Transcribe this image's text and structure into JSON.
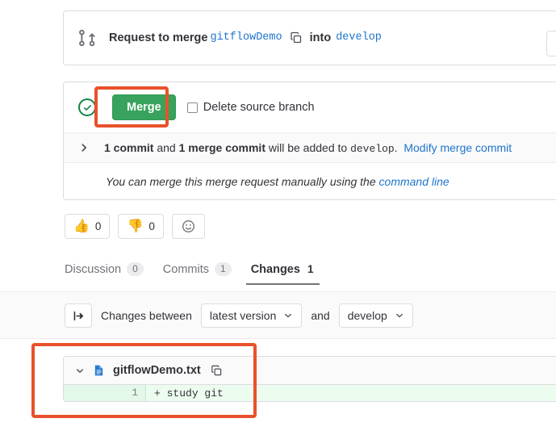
{
  "merge_request": {
    "icon": "merge-request-icon",
    "title_prefix": "Request to merge",
    "source_branch": "gitflowDemo",
    "copy_icon": "copy-icon",
    "into_word": "into",
    "target_branch": "develop"
  },
  "merge_widget": {
    "status_icon": "check-circle-icon",
    "merge_button": "Merge",
    "delete_source_branch_label": "Delete source branch",
    "delete_source_branch_checked": false,
    "expand_icon": "chevron-right-icon",
    "commit_count_text": "1 commit",
    "and_word": "and",
    "merge_commit_text": "1 merge commit",
    "commit_suffix": "will be added to",
    "commit_target": "develop",
    "commit_period": ".",
    "modify_link": "Modify merge commit",
    "manual_text_prefix": "You can merge this merge request manually using the",
    "manual_link": "command line"
  },
  "awards": [
    {
      "name": "thumbsup",
      "emoji": "👍",
      "count": "0"
    },
    {
      "name": "thumbsdown",
      "emoji": "👎",
      "count": "0"
    }
  ],
  "award_add_icon": "smiley-add-reaction-icon",
  "tabs": [
    {
      "label": "Discussion",
      "count": "0",
      "active": false
    },
    {
      "label": "Commits",
      "count": "1",
      "active": false
    },
    {
      "label": "Changes",
      "count": "1",
      "active": true
    }
  ],
  "compare_bar": {
    "toggle_icon": "sidebar-toggle-icon",
    "label": "Changes between",
    "version_dropdown": "latest version",
    "and_word": "and",
    "target_dropdown": "develop",
    "chevron_icon": "chevron-down-icon"
  },
  "file_diff": {
    "collapse_icon": "chevron-down-icon",
    "file_icon": "document-icon",
    "file_name": "gitflowDemo.txt",
    "copy_icon": "copy-icon",
    "lines": [
      {
        "number": "1",
        "marker": "+",
        "content": "study git",
        "type": "added"
      }
    ]
  },
  "colors": {
    "merge_green": "#37a35c",
    "link_blue": "#1f75cb",
    "annotation_red": "#e8512a",
    "diff_add_bg": "#ecfdf0",
    "status_green": "#108548"
  }
}
